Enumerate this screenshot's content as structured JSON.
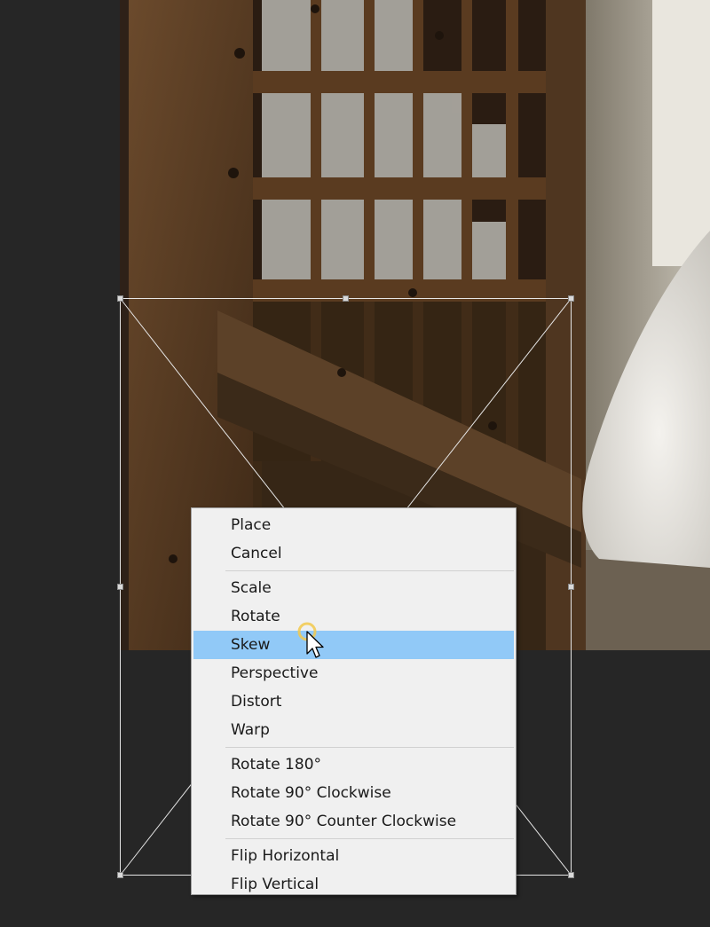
{
  "menu": {
    "groups": [
      [
        {
          "label": "Place"
        },
        {
          "label": "Cancel"
        }
      ],
      [
        {
          "label": "Scale"
        },
        {
          "label": "Rotate"
        },
        {
          "label": "Skew",
          "highlighted": true
        },
        {
          "label": "Perspective"
        },
        {
          "label": "Distort"
        },
        {
          "label": "Warp"
        }
      ],
      [
        {
          "label": "Rotate 180°"
        },
        {
          "label": "Rotate 90° Clockwise"
        },
        {
          "label": "Rotate 90° Counter Clockwise"
        }
      ],
      [
        {
          "label": "Flip Horizontal"
        },
        {
          "label": "Flip Vertical"
        }
      ]
    ]
  },
  "colors": {
    "canvas_background": "#262626",
    "menu_background": "#f0f0f0",
    "menu_highlight": "#91c9f7",
    "menu_text": "#1a1a1a",
    "cursor_halo": "#f2c94c"
  },
  "icons": {
    "cursor": "arrow-pointer-icon"
  }
}
